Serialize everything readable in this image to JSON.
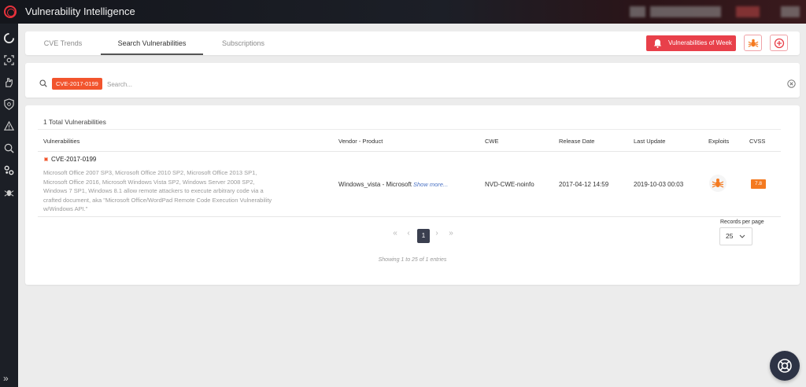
{
  "app": {
    "title": "Vulnerability Intelligence"
  },
  "tabs": [
    {
      "label": "CVE Trends",
      "active": false
    },
    {
      "label": "Search Vulnerabilities",
      "active": true
    },
    {
      "label": "Subscriptions",
      "active": false
    }
  ],
  "actions": {
    "vulnerabilities_of_week": "Vulnerabilities of Week"
  },
  "search": {
    "chip": "CVE-2017-0199",
    "placeholder": "Search..."
  },
  "results": {
    "total": "1 Total Vulnerabilities",
    "columns": {
      "vulnerabilities": "Vulnerabilities",
      "vendor_product": "Vendor - Product",
      "cwe": "CWE",
      "release_date": "Release Date",
      "last_update": "Last Update",
      "exploits": "Exploits",
      "cvss": "CVSS"
    },
    "rows": [
      {
        "id": "CVE-2017-0199",
        "description": "Microsoft Office 2007 SP3, Microsoft Office 2010 SP2, Microsoft Office 2013 SP1, Microsoft Office 2016, Microsoft Windows Vista SP2, Windows Server 2008 SP2, Windows 7 SP1, Windows 8.1 allow remote attackers to execute arbitrary code via a crafted document, aka \"Microsoft Office/WordPad Remote Code Execution Vulnerability w/Windows API.\"",
        "vendor_product": "Windows_vista - Microsoft",
        "show_more": "Show more...",
        "cwe": "NVD-CWE-noinfo",
        "release_date": "2017-04-12 14:59",
        "last_update": "2019-10-03 00:03",
        "cvss": "7.8"
      }
    ]
  },
  "pagination": {
    "current_page": "1",
    "showing": "Showing 1 to 25 of 1 entries"
  },
  "records_per_page": {
    "label": "Records per page",
    "value": "25"
  },
  "colors": {
    "accent_red": "#e8404a",
    "chip_orange": "#f2542d",
    "cvss_orange": "#f47a20",
    "sidebar": "#1c1f26"
  },
  "icons": [
    "logo-icon",
    "sidebar-dashboard-icon",
    "sidebar-scan-icon",
    "sidebar-hand-icon",
    "sidebar-shield-icon",
    "sidebar-alert-icon",
    "sidebar-search-icon",
    "sidebar-settings-icon",
    "sidebar-bug-icon",
    "expand-icon",
    "bell-icon",
    "bug-icon",
    "plus-circle-icon",
    "search-icon",
    "clear-icon",
    "help-icon"
  ]
}
